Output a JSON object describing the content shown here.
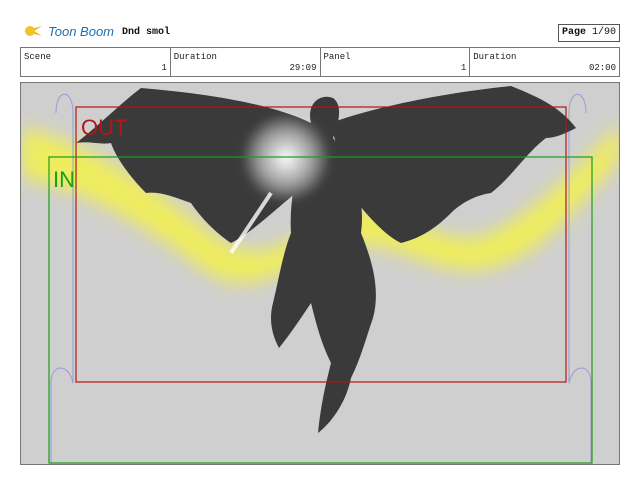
{
  "header": {
    "brand": "Toon Boom",
    "project": "Dnd smol",
    "page_label": "Page",
    "page_value": "1/90"
  },
  "info": {
    "scene_label": "Scene",
    "scene_value": "1",
    "duration_label": "Duration",
    "duration_value": "29:09",
    "panel_label": "Panel",
    "panel_value": "1",
    "panel_duration_label": "Duration",
    "panel_duration_value": "02:00"
  },
  "panel": {
    "out_label": "OUT",
    "in_label": "IN",
    "colors": {
      "out_frame": "#b01818",
      "in_frame": "#18a018",
      "glow": "#f4f24a",
      "figure": "#3a3a3a",
      "background": "#cfcfcf"
    }
  }
}
